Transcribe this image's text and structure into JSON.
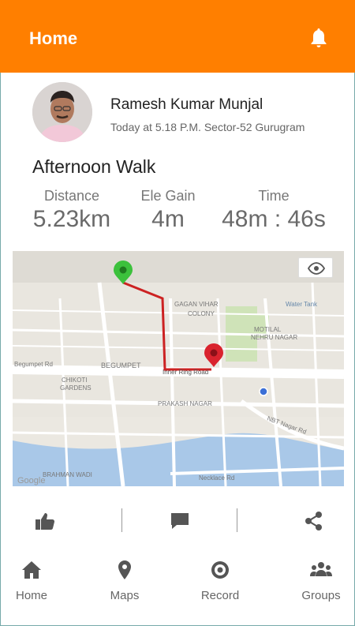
{
  "header": {
    "title": "Home"
  },
  "post": {
    "user_name": "Ramesh Kumar Munjal",
    "meta": "Today at 5.18 P.M. Sector-52 Gurugram",
    "activity_title": "Afternoon Walk"
  },
  "stats": [
    {
      "label": "Distance",
      "value": "5.23km"
    },
    {
      "label": "Ele Gain",
      "value": "4m"
    },
    {
      "label": "Time",
      "value": "48m : 46s"
    }
  ],
  "map": {
    "labels": {
      "begumpet_rd": "Begumpet Rd",
      "begumpet": "BEGUMPET",
      "inner_ring": "Inner Ring Road",
      "gagan_vihar": "GAGAN VIHAR",
      "colony": "COLONY",
      "water_tank": "Water Tank",
      "motilal": "MOTILAL",
      "nehru_nagar": "NEHRU NAGAR",
      "chikoti": "CHIKOTI",
      "gardens": "GARDENS",
      "prakash_nagar": "PRAKASH NAGAR",
      "nbt_nagar": "NBT Nagar Rd",
      "brahman_wadi": "BRAHMAN WADI",
      "necklace_rd": "Necklace Rd",
      "google": "Google"
    },
    "start_color": "#3cc13c",
    "end_color": "#d9232e",
    "route_color": "#cc2222"
  },
  "nav": {
    "items": [
      {
        "label": "Home",
        "icon": "home-icon"
      },
      {
        "label": "Maps",
        "icon": "map-pin-icon"
      },
      {
        "label": "Record",
        "icon": "record-icon"
      },
      {
        "label": "Groups",
        "icon": "groups-icon"
      }
    ]
  },
  "colors": {
    "accent": "#ff7f00",
    "icon": "#555555"
  }
}
